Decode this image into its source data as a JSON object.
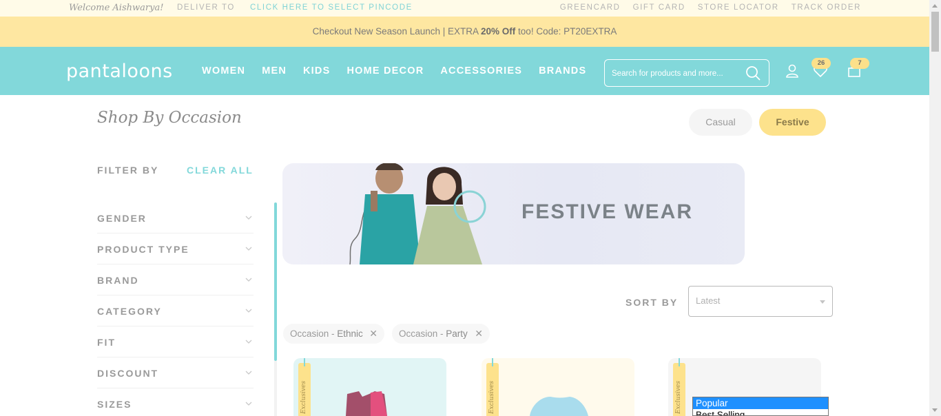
{
  "topbar": {
    "welcome": "Welcome Aishwarya!",
    "deliver_to": "DELIVER TO",
    "pincode_link": "CLICK HERE TO SELECT PINCODE",
    "links": [
      "GREENCARD",
      "GIFT CARD",
      "STORE LOCATOR",
      "TRACK ORDER"
    ]
  },
  "promo": {
    "prefix": "Checkout New Season Launch | EXTRA ",
    "highlight": "20% Off",
    "suffix": " too! Code: PT20EXTRA"
  },
  "header": {
    "logo": "pantaloons",
    "nav": [
      "WOMEN",
      "MEN",
      "KIDS",
      "HOME DECOR",
      "ACCESSORIES",
      "BRANDS"
    ],
    "search_placeholder": "Search for products and more...",
    "wishlist_count": "26",
    "cart_count": "7"
  },
  "occasion": {
    "title": "Shop By Occasion",
    "options": [
      "Casual",
      "Festive"
    ],
    "selected": "Festive"
  },
  "filters": {
    "heading": "FILTER BY",
    "clear": "CLEAR ALL",
    "items": [
      "GENDER",
      "PRODUCT TYPE",
      "BRAND",
      "CATEGORY",
      "FIT",
      "DISCOUNT",
      "SIZES"
    ]
  },
  "banner": {
    "text": "FESTIVE WEAR"
  },
  "sort": {
    "label": "SORT BY",
    "value": "Latest",
    "options": [
      "Popular",
      "Best Selling"
    ],
    "highlighted": "Popular"
  },
  "chips": [
    {
      "prefix": "Occasion - ",
      "value": "Ethnic"
    },
    {
      "prefix": "Occasion - ",
      "value": "Party"
    }
  ],
  "cards": [
    {
      "tag": "Exclusives"
    },
    {
      "tag": "Exclusives"
    },
    {
      "tag": "Exclusives"
    }
  ],
  "colors": {
    "teal": "#82d8da",
    "promo_yellow": "#fee7a1",
    "badge_yellow": "#fde28c",
    "topbar_bg": "#fffbe8"
  }
}
